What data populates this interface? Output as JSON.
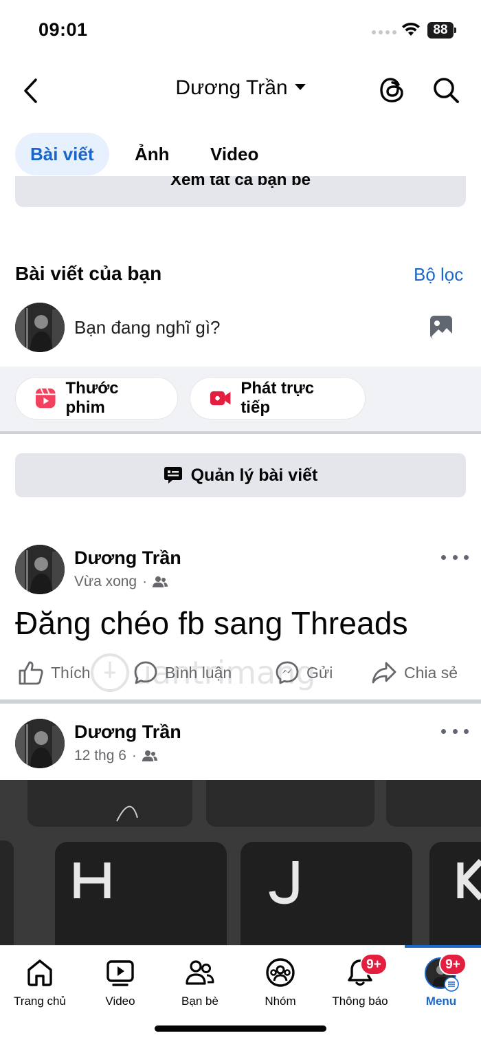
{
  "status_bar": {
    "time": "09:01",
    "battery": "88"
  },
  "header": {
    "title": "Dương Trần"
  },
  "tabs": [
    {
      "label": "Bài viết"
    },
    {
      "label": "Ảnh"
    },
    {
      "label": "Video"
    }
  ],
  "see_friends_label": "Xem tất cả bạn bè",
  "section": {
    "title": "Bài viết của bạn",
    "filter_label": "Bộ lọc"
  },
  "composer": {
    "placeholder": "Bạn đang nghĩ gì?"
  },
  "quick_actions": [
    {
      "label": "Thước phim",
      "icon": "reels-icon",
      "color": "#f3425f"
    },
    {
      "label": "Phát trực tiếp",
      "icon": "live-video-icon",
      "color": "#e41e3f"
    }
  ],
  "manage_posts_label": "Quản lý bài viết",
  "posts": [
    {
      "author": "Dương Trần",
      "time": "Vừa xong",
      "audience_icon": "friends-icon",
      "text": "Đăng chéo fb sang Threads",
      "actions": [
        {
          "label": "Thích",
          "icon": "like-icon"
        },
        {
          "label": "Bình luận",
          "icon": "comment-icon"
        },
        {
          "label": "Gửi",
          "icon": "messenger-icon"
        },
        {
          "label": "Chia sẻ",
          "icon": "share-icon"
        }
      ]
    },
    {
      "author": "Dương Trần",
      "time": "12 thg 6",
      "audience_icon": "friends-icon"
    }
  ],
  "bottom_nav": [
    {
      "label": "Trang chủ",
      "icon": "home-icon"
    },
    {
      "label": "Video",
      "icon": "video-icon"
    },
    {
      "label": "Bạn bè",
      "icon": "friends-icon"
    },
    {
      "label": "Nhóm",
      "icon": "groups-icon"
    },
    {
      "label": "Thông báo",
      "icon": "bell-icon",
      "badge": "9+"
    },
    {
      "label": "Menu",
      "icon": "menu-avatar-icon",
      "badge": "9+",
      "active": true
    }
  ],
  "colors": {
    "accent": "#1a66c9",
    "badge": "#e41e3f",
    "muted": "#65676b"
  }
}
